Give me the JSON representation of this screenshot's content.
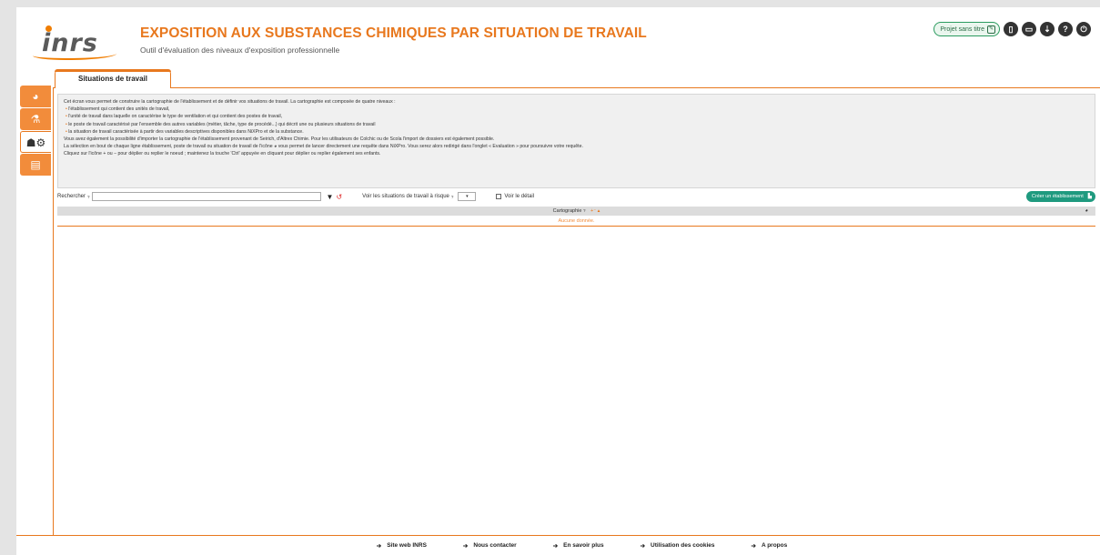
{
  "header": {
    "logo_text": "inrs",
    "title": "EXPOSITION AUX SUBSTANCES CHIMIQUES PAR SITUATION DE TRAVAIL",
    "subtitle": "Outil d'évaluation des niveaux d'exposition professionnelle",
    "project_label": "Projet sans titre",
    "accent_color": "#e8781e"
  },
  "toolbar_icons": [
    "new-file-icon",
    "open-folder-icon",
    "download-icon",
    "help-icon",
    "power-icon"
  ],
  "tab": {
    "label": "Situations de travail"
  },
  "sidenav": [
    {
      "name": "pie-chart-icon",
      "glyph": "◕"
    },
    {
      "name": "flask-icon",
      "glyph": "⚗"
    },
    {
      "name": "users-gear-icon",
      "glyph": "👥"
    },
    {
      "name": "document-icon",
      "glyph": "▤"
    }
  ],
  "info": {
    "intro": "Cet écran vous permet de construire la cartographie de l'établissement et de définir vos situations de travail. La cartographie est composée de quatre niveaux :",
    "items": [
      "l'établissement qui contient des unités de travail,",
      "l'unité de travail dans laquelle on caractérise le type de ventilation et qui contient des postes de travail,",
      "le poste de travail caractérisé par l'ensemble des autres variables (métier, tâche, type de procédé...) qui décrit une ou plusieurs situations de travail",
      "la situation de travail caractérisée à partir des variables descriptives disponibles dans NiXPro et de la substance."
    ],
    "para1": "Vous avez également la possibilité d'importer la cartographie de l'établissement provenant de Seirich, d'Altrex Chimie. Pour les utilisateurs de Colchic ou de Scola l'import de dossiers est également possible.",
    "para2": "La sélection en bout de chaque ligne établissement, poste de travail ou situation de travail de l'icône ◕ vous permet de lancer directement une requête dans NiXPro. Vous serez alors redirigé dans l'onglet « Evaluation » pour poursuivre votre requête.",
    "para3": "Cliquez sur l'icône + ou − pour déplier ou replier le noeud ; maintenez la touche 'Ctrl' appuyée en cliquant pour déplier ou replier également ses enfants."
  },
  "search": {
    "label": "Rechercher",
    "help": "?",
    "value": ""
  },
  "risk": {
    "label": "Voir les situations de travail à risque",
    "help": "?",
    "value": "▾"
  },
  "detail": {
    "label": "Voir le détail"
  },
  "create_button": {
    "label": "Créer un établissement"
  },
  "table": {
    "header": "Cartographie",
    "help": "?",
    "sort": "+⁻ ▴",
    "empty": "Aucune donnée."
  },
  "footer": {
    "links": [
      {
        "label": "Site web INRS"
      },
      {
        "label": "Nous contacter"
      },
      {
        "label": "En savoir plus"
      },
      {
        "label": "Utilisation des cookies"
      },
      {
        "label": "A propos"
      }
    ]
  }
}
